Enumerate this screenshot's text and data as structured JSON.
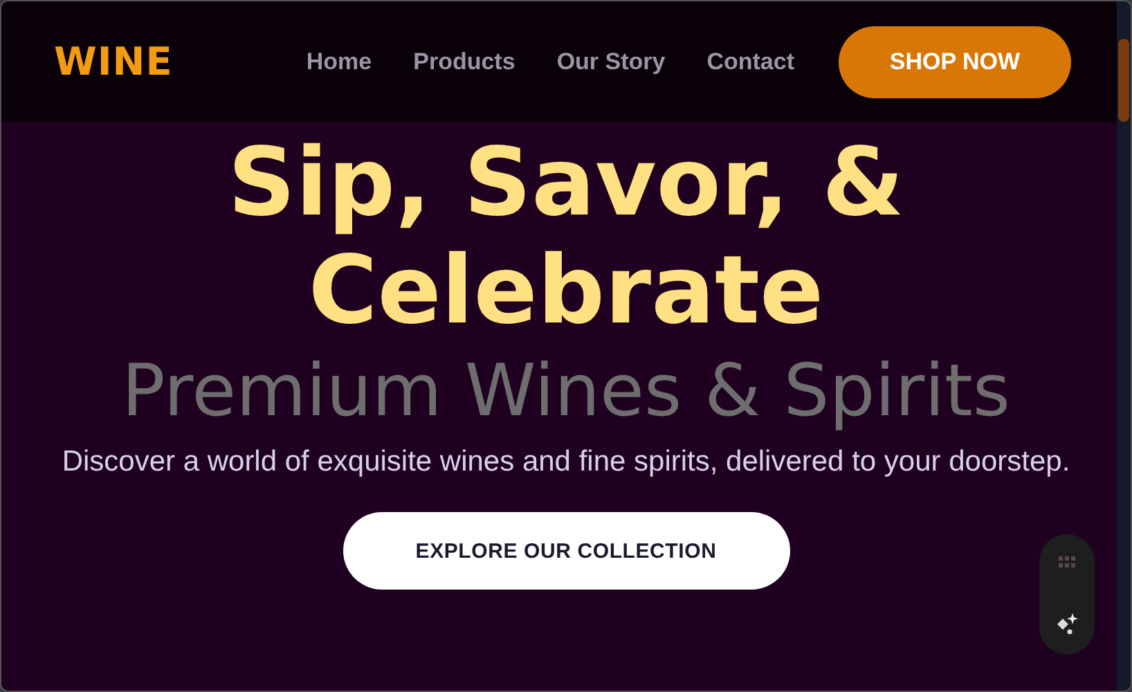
{
  "header": {
    "logo": "WINE",
    "nav": [
      {
        "label": "Home"
      },
      {
        "label": "Products"
      },
      {
        "label": "Our Story"
      },
      {
        "label": "Contact"
      }
    ],
    "cta": "SHOP NOW"
  },
  "hero": {
    "title_lines": [
      "Sip, Savor, &",
      "Celebrate"
    ],
    "subtitle": "Premium Wines & Spirits",
    "description": "Discover a world of exquisite wines and fine spirits, delivered to your doorstep.",
    "button": "EXPLORE OUR COLLECTION"
  }
}
